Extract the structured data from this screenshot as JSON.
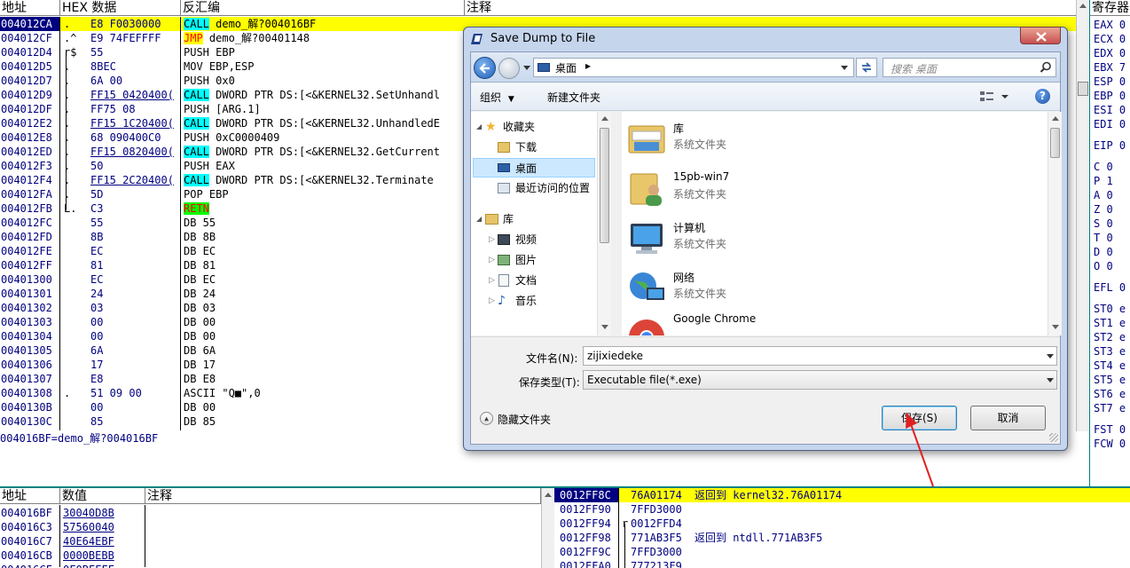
{
  "disasm": {
    "headers": {
      "addr": "地址",
      "hex": "HEX 数据",
      "disasm": "反汇编",
      "comment": "注释"
    },
    "rows": [
      {
        "addr": "004012CA",
        "mk": ".",
        "hex": "E8 F0030000",
        "ins": [
          {
            "t": "CALL",
            "s": "call"
          },
          {
            "t": " demo_解?004016BF"
          }
        ],
        "rowhl": "yellow",
        "sel": true
      },
      {
        "addr": "004012CF",
        "mk": ".^",
        "hex": "E9 74FEFFFF",
        "ins": [
          {
            "t": "JMP",
            "s": "jmp"
          },
          {
            "t": " demo_解?00401148"
          }
        ]
      },
      {
        "addr": "004012D4",
        "mk": "r$",
        "hex": "55",
        "ins": [
          {
            "t": "PUSH EBP"
          }
        ]
      },
      {
        "addr": "004012D5",
        "mk": ".",
        "hex": "8BEC",
        "ins": [
          {
            "t": "MOV EBP,ESP"
          }
        ]
      },
      {
        "addr": "004012D7",
        "mk": ".",
        "hex": "6A 00",
        "ins": [
          {
            "t": "PUSH 0x0"
          }
        ]
      },
      {
        "addr": "004012D9",
        "mk": ".",
        "hex": "FF15 0420400(",
        "ins": [
          {
            "t": "CALL",
            "s": "call"
          },
          {
            "t": " DWORD PTR DS:[<&KERNEL32.SetUnhandl"
          }
        ]
      },
      {
        "addr": "004012DF",
        "mk": ".",
        "hex": "FF75 08",
        "ins": [
          {
            "t": "PUSH [ARG.1]"
          }
        ]
      },
      {
        "addr": "004012E2",
        "mk": ".",
        "hex": "FF15 1C20400(",
        "ins": [
          {
            "t": "CALL",
            "s": "call"
          },
          {
            "t": " DWORD PTR DS:[<&KERNEL32.UnhandledE"
          }
        ]
      },
      {
        "addr": "004012E8",
        "mk": ".",
        "hex": "68 090400C0",
        "ins": [
          {
            "t": "PUSH 0xC0000409"
          }
        ]
      },
      {
        "addr": "004012ED",
        "mk": ".",
        "hex": "FF15 0820400(",
        "ins": [
          {
            "t": "CALL",
            "s": "call"
          },
          {
            "t": " DWORD PTR DS:[<&KERNEL32.GetCurrent"
          }
        ]
      },
      {
        "addr": "004012F3",
        "mk": ".",
        "hex": "50",
        "ins": [
          {
            "t": "PUSH EAX"
          }
        ]
      },
      {
        "addr": "004012F4",
        "mk": ".",
        "hex": "FF15 2C20400(",
        "ins": [
          {
            "t": "CALL",
            "s": "call"
          },
          {
            "t": " DWORD PTR DS:[<&KERNEL32.Terminate"
          }
        ]
      },
      {
        "addr": "004012FA",
        "mk": ".",
        "hex": "5D",
        "ins": [
          {
            "t": "POP EBP"
          }
        ]
      },
      {
        "addr": "004012FB",
        "mk": "L.",
        "hex": "C3",
        "ins": [
          {
            "t": "RETN",
            "s": "retn"
          }
        ]
      },
      {
        "addr": "004012FC",
        "mk": "",
        "hex": "55",
        "ins": [
          {
            "t": "DB 55"
          }
        ]
      },
      {
        "addr": "004012FD",
        "mk": "",
        "hex": "8B",
        "ins": [
          {
            "t": "DB 8B"
          }
        ]
      },
      {
        "addr": "004012FE",
        "mk": "",
        "hex": "EC",
        "ins": [
          {
            "t": "DB EC"
          }
        ]
      },
      {
        "addr": "004012FF",
        "mk": "",
        "hex": "81",
        "ins": [
          {
            "t": "DB 81"
          }
        ]
      },
      {
        "addr": "00401300",
        "mk": "",
        "hex": "EC",
        "ins": [
          {
            "t": "DB EC"
          }
        ]
      },
      {
        "addr": "00401301",
        "mk": "",
        "hex": "24",
        "ins": [
          {
            "t": "DB 24"
          }
        ]
      },
      {
        "addr": "00401302",
        "mk": "",
        "hex": "03",
        "ins": [
          {
            "t": "DB 03"
          }
        ]
      },
      {
        "addr": "00401303",
        "mk": "",
        "hex": "00",
        "ins": [
          {
            "t": "DB 00"
          }
        ]
      },
      {
        "addr": "00401304",
        "mk": "",
        "hex": "00",
        "ins": [
          {
            "t": "DB 00"
          }
        ]
      },
      {
        "addr": "00401305",
        "mk": "",
        "hex": "6A",
        "ins": [
          {
            "t": "DB 6A"
          }
        ]
      },
      {
        "addr": "00401306",
        "mk": "",
        "hex": "17",
        "ins": [
          {
            "t": "DB 17"
          }
        ]
      },
      {
        "addr": "00401307",
        "mk": "",
        "hex": "E8",
        "ins": [
          {
            "t": "DB E8"
          }
        ]
      },
      {
        "addr": "00401308",
        "mk": ".",
        "hex": "51 09 00",
        "ins": [
          {
            "t": "ASCII \"Q■\",0"
          }
        ]
      },
      {
        "addr": "0040130B",
        "mk": "",
        "hex": "00",
        "ins": [
          {
            "t": "DB 00"
          }
        ]
      },
      {
        "addr": "0040130C",
        "mk": "",
        "hex": "85",
        "ins": [
          {
            "t": "DB 85"
          }
        ]
      }
    ],
    "info_line": "004016BF=demo_解?004016BF"
  },
  "registers": {
    "header": "寄存器",
    "items": [
      "EAX 0",
      "ECX 0",
      "EDX 0",
      "EBX 7",
      "ESP 0",
      "EBP 0",
      "ESI 0",
      "EDI 0",
      "",
      "EIP 0",
      "",
      "C 0",
      "P 1",
      "A 0",
      "Z 0",
      "S 0",
      "T 0",
      "D 0",
      "O 0",
      "",
      "EFL 0",
      "",
      "ST0 e",
      "ST1 e",
      "ST2 e",
      "ST3 e",
      "ST4 e",
      "ST5 e",
      "ST6 e",
      "ST7 e",
      "",
      "FST 0",
      "FCW 0"
    ]
  },
  "dump": {
    "headers": {
      "addr": "地址",
      "val": "数值",
      "comment": "注释"
    },
    "rows": [
      {
        "addr": "004016BF",
        "val": "30040D8B"
      },
      {
        "addr": "004016C3",
        "val": "57560040"
      },
      {
        "addr": "004016C7",
        "val": "40E64EBF"
      },
      {
        "addr": "004016CB",
        "val": "0000BEBB"
      },
      {
        "addr": "004016CF",
        "val": "0F0BFFFF"
      }
    ]
  },
  "stack": {
    "rows": [
      {
        "addr": "0012FF8C",
        "val": "76A01174",
        "comment": "返回到 kernel32.76A01174",
        "hl": true
      },
      {
        "addr": "0012FF90",
        "val": "7FFD3000",
        "comment": ""
      },
      {
        "addr": "0012FF94",
        "val": "0012FFD4",
        "comment": "",
        "mk": "r"
      },
      {
        "addr": "0012FF98",
        "val": "771AB3F5",
        "comment": "返回到 ntdll.771AB3F5"
      },
      {
        "addr": "0012FF9C",
        "val": "7FFD3000",
        "comment": ""
      },
      {
        "addr": "0012FFA0",
        "val": "777213F9",
        "comment": ""
      }
    ]
  },
  "dialog": {
    "title": "Save Dump to File",
    "path": "桌面",
    "search_placeholder": "搜索 桌面",
    "organize": "组织",
    "new_folder": "新建文件夹",
    "tree": {
      "favorites": "收藏夹",
      "downloads": "下载",
      "desktop": "桌面",
      "recent": "最近访问的位置",
      "libraries": "库",
      "videos": "视频",
      "pictures": "图片",
      "documents": "文档",
      "music": "音乐"
    },
    "files": [
      {
        "name": "库",
        "type": "系统文件夹"
      },
      {
        "name": "15pb-win7",
        "type": "系统文件夹"
      },
      {
        "name": "计算机",
        "type": "系统文件夹"
      },
      {
        "name": "网络",
        "type": "系统文件夹"
      },
      {
        "name": "Google Chrome",
        "type": ""
      }
    ],
    "filename_label": "文件名(N):",
    "filename_value": "zijixiedeke",
    "filetype_label": "保存类型(T):",
    "filetype_value": "Executable file(*.exe)",
    "hide_folders": "隐藏文件夹",
    "save": "保存(S)",
    "cancel": "取消",
    "colors": {
      "title_bar": "#c5d5ec",
      "selection": "#cce8ff",
      "close": "#c75050"
    }
  }
}
